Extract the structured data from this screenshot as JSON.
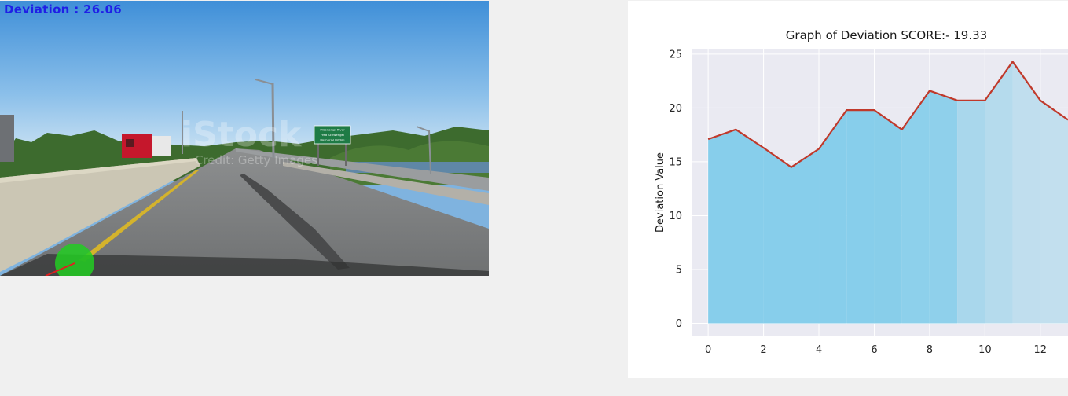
{
  "video": {
    "overlay_label": "Deviation",
    "overlay_separator": " : ",
    "overlay_value": "26.06",
    "overlay_color": "#1f1fe6",
    "watermark_text": "iStock",
    "watermark_sub": "Credit: Getty Images",
    "sign_lines": [
      "Mississippi River",
      "Fred Schwengel",
      "Memorial Bridge"
    ],
    "indicator_circle_color": "#22cc22",
    "indicator_line_color": "#e02020"
  },
  "chart_data": {
    "type": "area",
    "title": "Graph of Deviation SCORE:- 19.33",
    "xlabel": "",
    "ylabel": "Deviation Value",
    "x": [
      0,
      1,
      2,
      3,
      4,
      5,
      6,
      7,
      8,
      9,
      10,
      11,
      12,
      13
    ],
    "values": [
      17.1,
      18.0,
      16.3,
      14.5,
      16.2,
      19.8,
      19.8,
      18.0,
      21.6,
      20.7,
      20.7,
      24.3,
      20.7,
      18.9
    ],
    "xlim": [
      -0.6,
      13
    ],
    "ylim": [
      -1.2,
      25.5
    ],
    "xticks": [
      "0",
      "2",
      "4",
      "6",
      "8",
      "10",
      "12"
    ],
    "yticks": [
      "0",
      "5",
      "10",
      "15",
      "20",
      "25"
    ],
    "grid": true,
    "fill_color": "#87ceeb",
    "line_color": "#c0392b",
    "background_color": "#eaeaf2"
  }
}
